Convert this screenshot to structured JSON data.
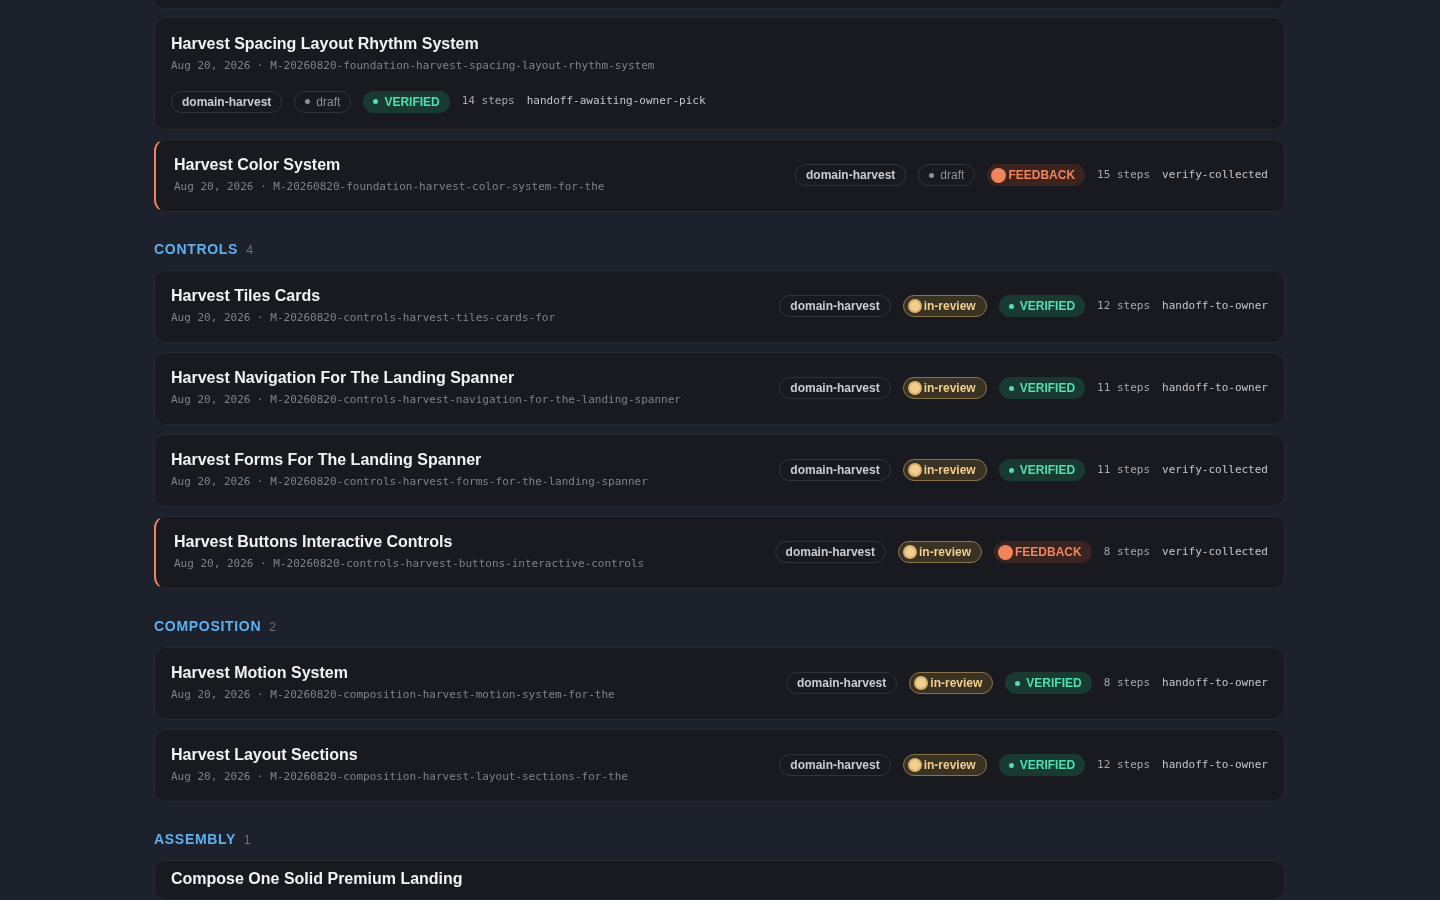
{
  "sections": [
    {
      "items": [
        {
          "title": "Harvest Spacing Layout Rhythm System",
          "meta": "Aug 20, 2026 · M-20260820-foundation-harvest-spacing-layout-rhythm-system",
          "kind": "stacked",
          "tag": "domain-harvest",
          "status": {
            "kind": "draft",
            "label": "draft"
          },
          "verdict": {
            "kind": "verified",
            "label": "VERIFIED"
          },
          "steps": "14 steps",
          "next": "handoff-awaiting-owner-pick"
        },
        {
          "title": "Harvest Color System",
          "meta": "Aug 20, 2026 · M-20260820-foundation-harvest-color-system-for-the",
          "kind": "inline",
          "tag": "domain-harvest",
          "status": {
            "kind": "draft",
            "label": "draft"
          },
          "verdict": {
            "kind": "feedback",
            "label": "FEEDBACK"
          },
          "steps": "15 steps",
          "next": "verify-collected"
        }
      ]
    },
    {
      "heading": "CONTROLS",
      "count": "4",
      "items": [
        {
          "title": "Harvest Tiles Cards",
          "meta": "Aug 20, 2026 · M-20260820-controls-harvest-tiles-cards-for",
          "kind": "inline",
          "tag": "domain-harvest",
          "status": {
            "kind": "in-review",
            "label": "in-review"
          },
          "verdict": {
            "kind": "verified",
            "label": "VERIFIED"
          },
          "steps": "12 steps",
          "next": "handoff-to-owner"
        },
        {
          "title": "Harvest Navigation For The Landing Spanner",
          "meta": "Aug 20, 2026 · M-20260820-controls-harvest-navigation-for-the-landing-spanner",
          "kind": "inline",
          "tag": "domain-harvest",
          "status": {
            "kind": "in-review",
            "label": "in-review"
          },
          "verdict": {
            "kind": "verified",
            "label": "VERIFIED"
          },
          "steps": "11 steps",
          "next": "handoff-to-owner"
        },
        {
          "title": "Harvest Forms For The Landing Spanner",
          "meta": "Aug 20, 2026 · M-20260820-controls-harvest-forms-for-the-landing-spanner",
          "kind": "inline",
          "tag": "domain-harvest",
          "status": {
            "kind": "in-review",
            "label": "in-review"
          },
          "verdict": {
            "kind": "verified",
            "label": "VERIFIED"
          },
          "steps": "11 steps",
          "next": "verify-collected"
        },
        {
          "title": "Harvest Buttons Interactive Controls",
          "meta": "Aug 20, 2026 · M-20260820-controls-harvest-buttons-interactive-controls",
          "kind": "inline",
          "tag": "domain-harvest",
          "status": {
            "kind": "in-review",
            "label": "in-review"
          },
          "verdict": {
            "kind": "feedback",
            "label": "FEEDBACK"
          },
          "steps": "8 steps",
          "next": "verify-collected"
        }
      ]
    },
    {
      "heading": "COMPOSITION",
      "count": "2",
      "items": [
        {
          "title": "Harvest Motion System",
          "meta": "Aug 20, 2026 · M-20260820-composition-harvest-motion-system-for-the",
          "kind": "inline",
          "tag": "domain-harvest",
          "status": {
            "kind": "in-review",
            "label": "in-review"
          },
          "verdict": {
            "kind": "verified",
            "label": "VERIFIED"
          },
          "steps": "8 steps",
          "next": "handoff-to-owner"
        },
        {
          "title": "Harvest Layout Sections",
          "meta": "Aug 20, 2026 · M-20260820-composition-harvest-layout-sections-for-the",
          "kind": "inline",
          "tag": "domain-harvest",
          "status": {
            "kind": "in-review",
            "label": "in-review"
          },
          "verdict": {
            "kind": "verified",
            "label": "VERIFIED"
          },
          "steps": "12 steps",
          "next": "handoff-to-owner"
        }
      ]
    },
    {
      "heading": "ASSEMBLY",
      "count": "1",
      "items": [
        {
          "title": "Compose One Solid Premium Landing",
          "kind": "cut"
        }
      ]
    }
  ]
}
